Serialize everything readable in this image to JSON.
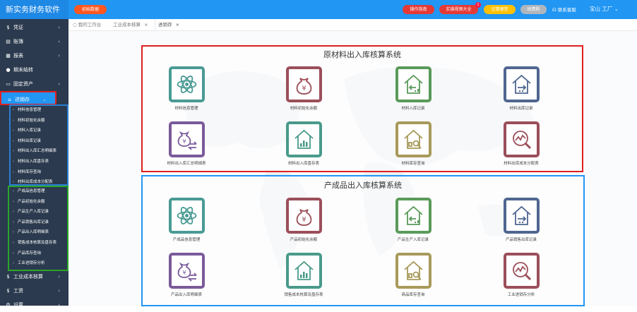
{
  "app": {
    "title": "新实务财务软件"
  },
  "topbar": {
    "start_label": "初始数据",
    "guide_label": "操作指南",
    "lessons_label": "实操视频大全",
    "lessons_badge": "1",
    "notes_label": "记事便签",
    "renew_label": "续费购",
    "support_label": "联系客服",
    "company_label": "宝山     工厂",
    "colors": {
      "bar": "#2196f3",
      "orange": "#ff5722",
      "red": "#e53935",
      "yellow": "#ffc107",
      "renew": "#b0b6bd"
    }
  },
  "sidebar": {
    "items": [
      {
        "icon": "$",
        "label": "凭证",
        "chevron": "‹"
      },
      {
        "icon": "▤",
        "label": "账簿",
        "chevron": "‹"
      },
      {
        "icon": "▦",
        "label": "报表",
        "chevron": "‹"
      },
      {
        "icon": "●",
        "label": "期末结转",
        "chevron": ""
      },
      {
        "icon": "▭",
        "label": "固定资产",
        "chevron": "‹"
      },
      {
        "icon": "⌂",
        "label": "进销存",
        "chevron": "⌄"
      }
    ],
    "material_sub": [
      "材料信息管理",
      "材料初始化余额",
      "材料入库记录",
      "材料出库记录",
      "材料出入库汇总明细表",
      "材料出入库盘存表",
      "材料库存查询",
      "材料出库成本分配表"
    ],
    "product_sub": [
      "产成品信息管理",
      "产品初始化余额",
      "产品生产入库记录",
      "产品销售出库记录",
      "产品出入库明细表",
      "销售成本核算及盘存表",
      "产品库存查询",
      "工业进销存分析"
    ],
    "bottom_items": [
      {
        "icon": "$",
        "label": "工业成本核算",
        "chevron": "‹"
      },
      {
        "icon": "$",
        "label": "工资",
        "chevron": "‹"
      },
      {
        "icon": "⚙",
        "label": "设置",
        "chevron": "‹"
      }
    ]
  },
  "tabs": [
    {
      "label": "我的工作台",
      "icon": "○"
    },
    {
      "label": "工业成本核算",
      "close": "×"
    },
    {
      "label": "进销存",
      "close": "×"
    }
  ],
  "panels": {
    "material": {
      "title": "原材料出入库核算系统",
      "tiles": [
        {
          "label": "材料信息管理",
          "icon": "atom-icon",
          "color": "#4a9a94"
        },
        {
          "label": "材料初始化余额",
          "icon": "money-bag-icon",
          "color": "#9b4f5a"
        },
        {
          "label": "材料入库记录",
          "icon": "house-in-icon",
          "color": "#5a9a5a"
        },
        {
          "label": "材料出库记录",
          "icon": "house-out-icon",
          "color": "#4f6690"
        },
        {
          "label": "材料出入库汇总明细表",
          "icon": "money-transfer-icon",
          "color": "#7a5a9a"
        },
        {
          "label": "材料出入库盘存表",
          "icon": "house-bars-icon",
          "color": "#4a9a8a"
        },
        {
          "label": "材料库存查询",
          "icon": "house-search-icon",
          "color": "#a89a5a"
        },
        {
          "label": "材料出库成本分配表",
          "icon": "chart-search-icon",
          "color": "#9b4f5a"
        }
      ]
    },
    "product": {
      "title": "产成品出入库核算系统",
      "tiles": [
        {
          "label": "产成品信息管理",
          "icon": "atom-icon",
          "color": "#4a9a94"
        },
        {
          "label": "产品初始化余额",
          "icon": "money-bag-icon",
          "color": "#9b4f5a"
        },
        {
          "label": "产品生产入库记录",
          "icon": "house-in-icon",
          "color": "#5a9a5a"
        },
        {
          "label": "产品销售出库记录",
          "icon": "house-out-icon",
          "color": "#4f6690"
        },
        {
          "label": "产品出入库明细表",
          "icon": "money-transfer-icon",
          "color": "#7a5a9a"
        },
        {
          "label": "销售成本核算及盘存表",
          "icon": "house-bars-icon",
          "color": "#4a9a8a"
        },
        {
          "label": "商品库存查询",
          "icon": "house-search-icon",
          "color": "#a89a5a"
        },
        {
          "label": "工业进销存分析",
          "icon": "chart-search-icon",
          "color": "#9b4f5a"
        }
      ]
    }
  }
}
